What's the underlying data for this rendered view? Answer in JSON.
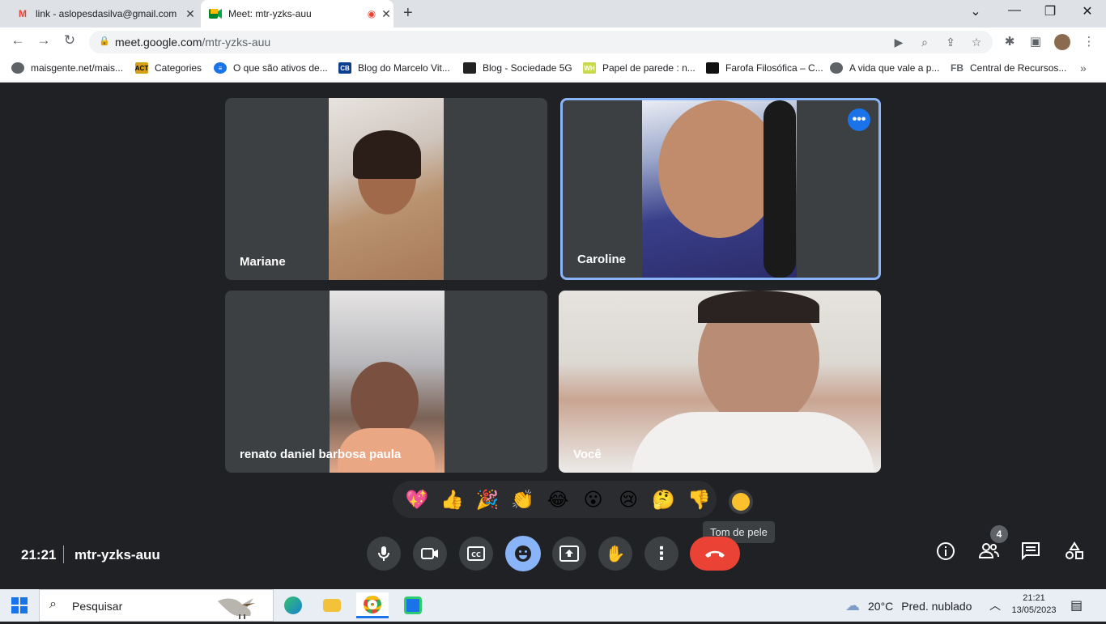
{
  "browser": {
    "tabs": [
      {
        "title": "link - aslopesdasilva@gmail.com",
        "icon": "gmail-icon",
        "color": "#ea4335"
      },
      {
        "title": "Meet: mtr-yzks-auu",
        "icon": "meet-icon",
        "recording_color": "#ea4335"
      }
    ],
    "url": {
      "host": "meet.google.com",
      "path": "/mtr-yzks-auu"
    },
    "bookmarks": [
      {
        "label": "maisgente.net/mais...",
        "color": "#5f6368"
      },
      {
        "label": "Categories",
        "color": "#d4a017"
      },
      {
        "label": "O que são ativos de...",
        "color": "#1a73e8"
      },
      {
        "label": "Blog do Marcelo Vit...",
        "color": "#0b3d91"
      },
      {
        "label": "Blog - Sociedade 5G",
        "color": "#222222"
      },
      {
        "label": "Papel de parede : n...",
        "color": "#c8d94c"
      },
      {
        "label": "Farofa Filosófica – C...",
        "color": "#111111"
      },
      {
        "label": "A vida que vale a p...",
        "color": "#5f6368"
      },
      {
        "label": "Central de Recursos...",
        "color": "#5f6368"
      }
    ]
  },
  "meet": {
    "participants": [
      {
        "name": "Mariane"
      },
      {
        "name": "Caroline"
      },
      {
        "name": "renato daniel barbosa paula"
      },
      {
        "name": "Você"
      }
    ],
    "reactions": [
      "💖",
      "👍",
      "🎉",
      "👏",
      "😂",
      "😮",
      "😢",
      "🤔",
      "👎"
    ],
    "skin_tone_tooltip": "Tom de pele",
    "time": "21:21",
    "code": "mtr-yzks-auu",
    "people_count": "4",
    "controls": [
      "mic-icon",
      "camera-icon",
      "captions-icon",
      "emoji-icon",
      "present-icon",
      "raise-hand-icon",
      "more-icon",
      "hangup-icon"
    ],
    "accent": "#8ab4f8",
    "hangup_color": "#ea4335"
  },
  "taskbar": {
    "search_placeholder": "Pesquisar",
    "weather": {
      "temp": "20°C",
      "desc": "Pred. nublado"
    },
    "time": "21:21",
    "date": "13/05/2023"
  }
}
